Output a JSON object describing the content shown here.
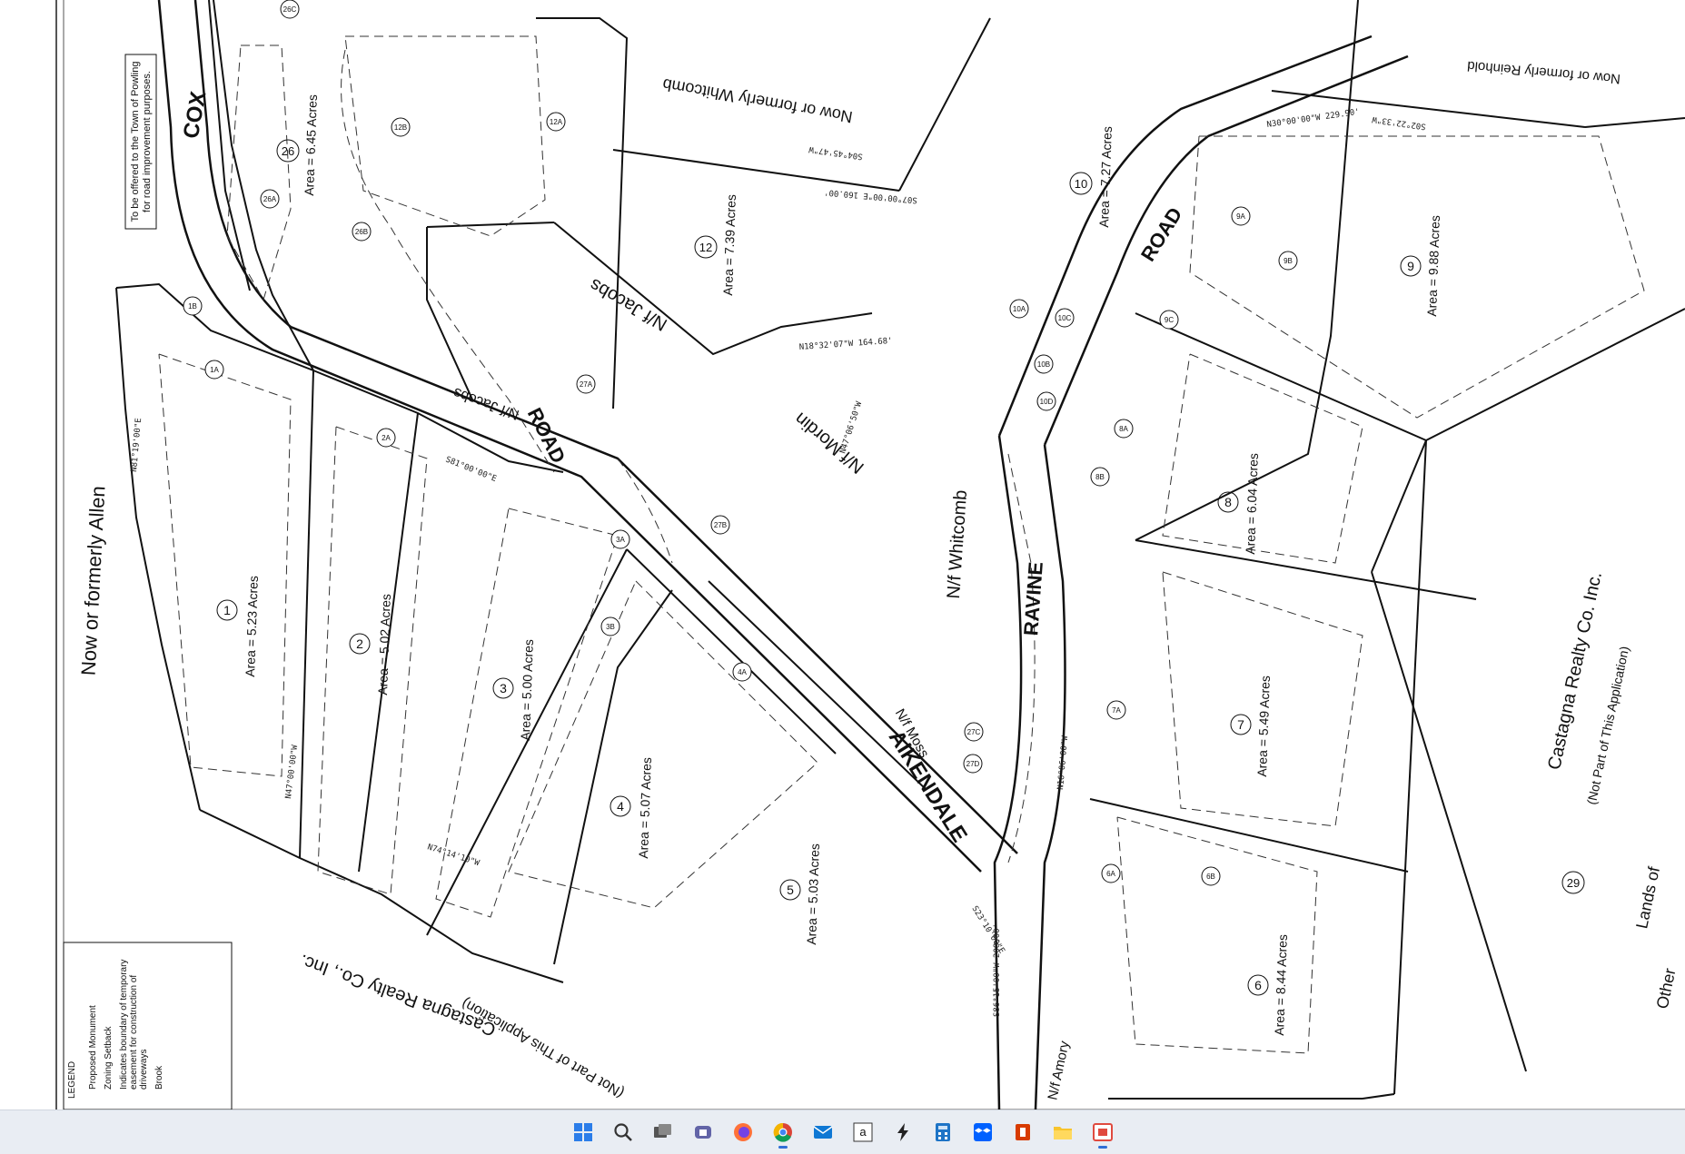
{
  "lots": {
    "lot1": {
      "num": "1",
      "area": "Area = 5.23 Acres"
    },
    "lot2": {
      "num": "2",
      "area": "Area = 5.02 Acres"
    },
    "lot3": {
      "num": "3",
      "area": "Area = 5.00 Acres"
    },
    "lot4": {
      "num": "4",
      "area": "Area = 5.07 Acres"
    },
    "lot5": {
      "num": "5",
      "area": "Area = 5.03 Acres"
    },
    "lot6": {
      "num": "6",
      "area": "Area = 8.44 Acres"
    },
    "lot7": {
      "num": "7",
      "area": "Area = 5.49 Acres"
    },
    "lot8": {
      "num": "8",
      "area": "Area = 6.04 Acres"
    },
    "lot9": {
      "num": "9",
      "area": "Area = 9.88 Acres"
    },
    "lot10": {
      "num": "10",
      "area": "Area = 7.27 Acres"
    },
    "lot12": {
      "num": "12",
      "area": "Area = 7.39 Acres"
    },
    "lot26": {
      "num": "26",
      "area": "Area = 6.45 Acres"
    },
    "lot29": {
      "num": "29"
    }
  },
  "roads": {
    "cox": "COX",
    "road_west": "ROAD",
    "aikendale": "AIKENDALE",
    "ravine": "RAVINE",
    "road_east": "ROAD"
  },
  "owners": {
    "allen": "Now or formerly Allen",
    "whitcomb_top": "Now or formerly Whitcomb",
    "nf_jacobs_1": "N/f Jacobs",
    "nf_jacobs_2": "N/f Jacobs",
    "nf_mordin": "N/f Mordin",
    "nf_whitcomb": "N/f Whitcomb",
    "nf_moss": "N/f Moss",
    "nf_amory": "N/f Amory",
    "reinhold": "Now or formerly Reinhold",
    "castagna_east_1": "Castagna Realty Co. Inc.",
    "castagna_east_2": "(Not Part of This Application)",
    "castagna_east_3": "Lands of",
    "castagna_east_4": "Other",
    "castagna_south_1": "Castagna Realty Co., Inc.",
    "castagna_south_2": "(Not Part of This Application)"
  },
  "notes": {
    "powling_1": "To be offered to the Town of Powling",
    "powling_2": "for road improvement purposes."
  },
  "legend": {
    "title": "LEGEND",
    "items": [
      "Proposed Monument",
      "Zoning Setback",
      "Indicates boundary of temporary",
      "easement for construction of",
      "driveways",
      "Brook"
    ]
  },
  "sub_lots": [
    "1A",
    "1B",
    "2A",
    "3A",
    "3B",
    "4A",
    "6A",
    "6B",
    "7A",
    "8A",
    "8B",
    "9A",
    "9B",
    "9C",
    "10A",
    "10B",
    "10C",
    "10D",
    "12A",
    "12B",
    "26A",
    "26B",
    "26C",
    "27A",
    "27B",
    "27C",
    "27D"
  ],
  "bearings": [
    "N81°19'00\"E",
    "S81°00'00\"E",
    "N47°00'00\"W",
    "S07°00'00\"E 160.00'",
    "S04°45'47\"W",
    "N18°32'07\"W 164.68'",
    "N47°06'50\"W",
    "N30°00'00\"W 229.90'",
    "S02°22'33\"W",
    "S23°10'00\"E",
    "N16°06'00\"W",
    "S86°15'00\"W 208.00'",
    "N74°14'10\"W"
  ],
  "taskbar": {
    "icons": [
      "windows-start-icon",
      "search-icon",
      "task-view-icon",
      "teams-icon",
      "firefox-icon",
      "chrome-icon",
      "mail-icon",
      "amazon-icon",
      "app-lightning-icon",
      "calculator-icon",
      "dropbox-icon",
      "office-icon",
      "file-explorer-icon",
      "snipping-tool-icon"
    ]
  },
  "colors": {
    "line": "#111111",
    "taskbar": "#e9edf3",
    "accent": "#2f6fd6"
  }
}
